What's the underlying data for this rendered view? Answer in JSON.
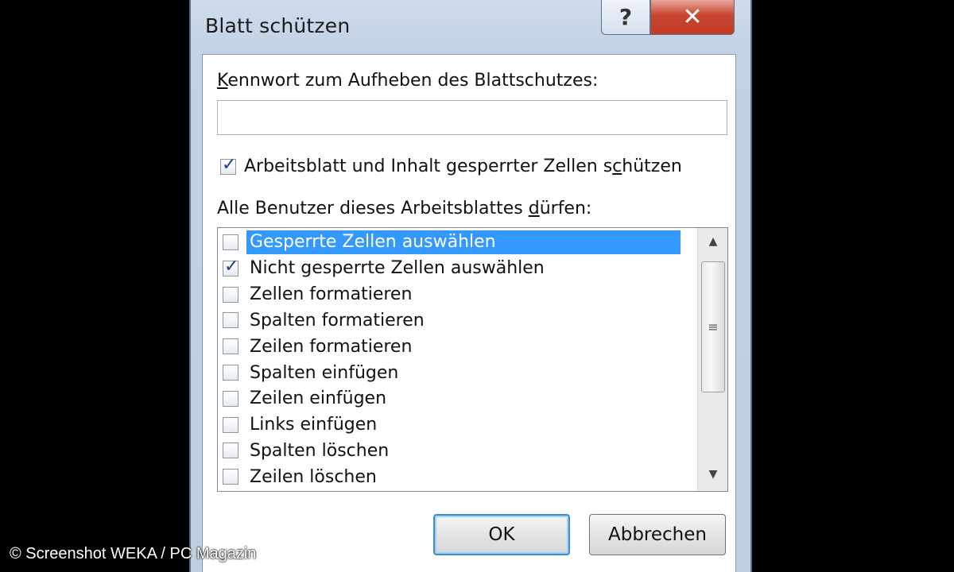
{
  "dialog": {
    "title": "Blatt schützen",
    "help_glyph": "?",
    "close_glyph": "✕"
  },
  "password": {
    "label_pre": "",
    "label_accel": "K",
    "label_post": "ennwort zum Aufheben des Blattschutzes:",
    "value": ""
  },
  "protect_checkbox": {
    "label_pre": "Arbeitsblatt und Inhalt gesperrter Zellen s",
    "label_accel": "c",
    "label_post": "hützen",
    "checked": true
  },
  "permissions": {
    "label_pre": "Alle Benutzer dieses Arbeitsblattes ",
    "label_accel": "d",
    "label_post": "ürfen:",
    "items": [
      {
        "label": "Gesperrte Zellen auswählen",
        "checked": false,
        "selected": true
      },
      {
        "label": "Nicht gesperrte Zellen auswählen",
        "checked": true,
        "selected": false
      },
      {
        "label": "Zellen formatieren",
        "checked": false,
        "selected": false
      },
      {
        "label": "Spalten formatieren",
        "checked": false,
        "selected": false
      },
      {
        "label": "Zeilen formatieren",
        "checked": false,
        "selected": false
      },
      {
        "label": "Spalten einfügen",
        "checked": false,
        "selected": false
      },
      {
        "label": "Zeilen einfügen",
        "checked": false,
        "selected": false
      },
      {
        "label": "Links einfügen",
        "checked": false,
        "selected": false
      },
      {
        "label": "Spalten löschen",
        "checked": false,
        "selected": false
      },
      {
        "label": "Zeilen löschen",
        "checked": false,
        "selected": false
      }
    ],
    "scroll_up_glyph": "▲",
    "scroll_down_glyph": "▼",
    "thumb_grip": "≡"
  },
  "buttons": {
    "ok_label": "OK",
    "cancel_label": "Abbrechen"
  },
  "credit": "© Screenshot WEKA / PC Magazin",
  "colors": {
    "selection": "#3399ff",
    "close_button": "#c9452f",
    "check_mark": "#1d3f8a"
  }
}
